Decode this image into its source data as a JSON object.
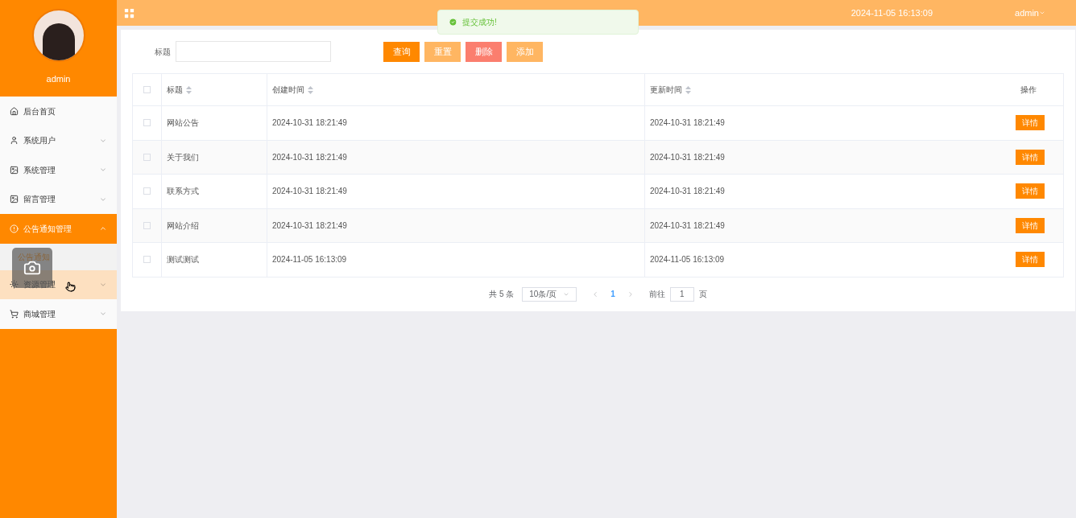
{
  "sidebar": {
    "user": "admin",
    "items": [
      {
        "label": "后台首页",
        "kind": "link",
        "selected": false,
        "hovered": false
      },
      {
        "label": "系统用户",
        "kind": "group",
        "expanded": false,
        "selected": false,
        "hovered": false
      },
      {
        "label": "系统管理",
        "kind": "group",
        "expanded": false,
        "selected": false,
        "hovered": false
      },
      {
        "label": "留言管理",
        "kind": "group",
        "expanded": false,
        "selected": false,
        "hovered": false
      },
      {
        "label": "公告通知管理",
        "kind": "group",
        "expanded": true,
        "selected": true,
        "hovered": false,
        "children": [
          {
            "label": "公告通知"
          }
        ]
      },
      {
        "label": "资源管理",
        "kind": "group",
        "expanded": false,
        "selected": false,
        "hovered": true
      },
      {
        "label": "商城管理",
        "kind": "group",
        "expanded": false,
        "selected": false,
        "hovered": false
      }
    ]
  },
  "header": {
    "datetime": "2024-11-05 16:13:09",
    "user": "admin"
  },
  "toast": {
    "message": "提交成功!"
  },
  "search": {
    "label": "标题",
    "buttons": [
      {
        "label": "查询",
        "kind": "primary"
      },
      {
        "label": "重置",
        "kind": "light"
      },
      {
        "label": "删除",
        "kind": "danger"
      },
      {
        "label": "添加",
        "kind": "light"
      }
    ]
  },
  "table": {
    "all_checked": false,
    "columns": [
      "标题",
      "创建时间",
      "更新时间",
      "操作"
    ],
    "rows": [
      {
        "title": "网站公告",
        "created": "2024-10-31 18:21:49",
        "updated": "2024-10-31 18:21:49",
        "action": "详情",
        "checked": false
      },
      {
        "title": "关于我们",
        "created": "2024-10-31 18:21:49",
        "updated": "2024-10-31 18:21:49",
        "action": "详情",
        "checked": false
      },
      {
        "title": "联系方式",
        "created": "2024-10-31 18:21:49",
        "updated": "2024-10-31 18:21:49",
        "action": "详情",
        "checked": false
      },
      {
        "title": "网站介绍",
        "created": "2024-10-31 18:21:49",
        "updated": "2024-10-31 18:21:49",
        "action": "详情",
        "checked": false
      },
      {
        "title": "测试测试",
        "created": "2024-11-05 16:13:09",
        "updated": "2024-11-05 16:13:09",
        "action": "详情",
        "checked": false
      }
    ]
  },
  "pagination": {
    "total": "共 5 条",
    "page_size": "10条/页",
    "pages": [
      {
        "label": "1",
        "selected": true
      }
    ],
    "goto_label": "前往",
    "goto_value": "1",
    "goto_suffix": "页"
  }
}
